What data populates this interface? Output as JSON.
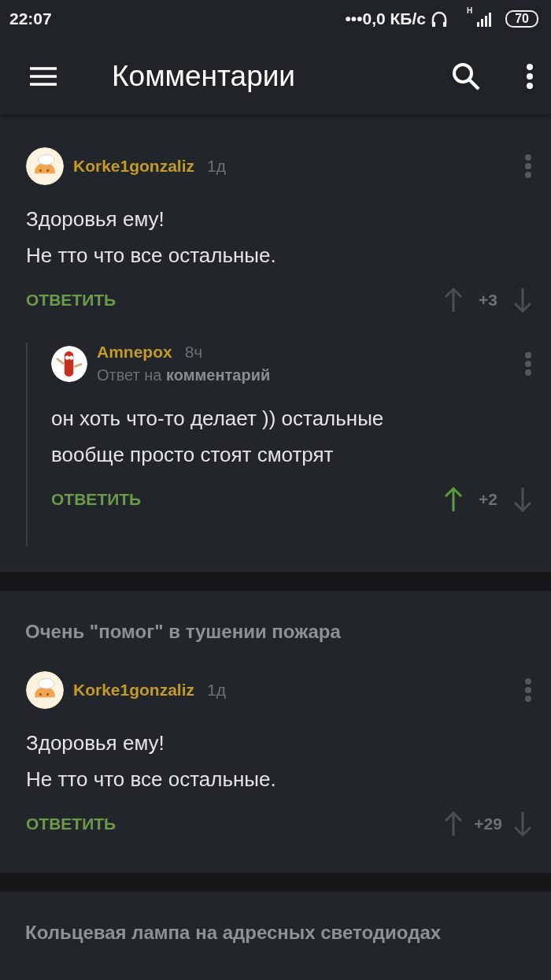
{
  "status_bar": {
    "time": "22:07",
    "speed": "•••0,0 КБ/с",
    "network": "H",
    "battery": "70"
  },
  "app_bar": {
    "title": "Комментарии"
  },
  "sections": [
    {
      "comments": [
        {
          "author": "Korke1gonzaliz",
          "avatar": {
            "kind": "chef"
          },
          "age": "1д",
          "lines": [
            "Здоровья ему!",
            "Не тто что все остальные."
          ],
          "reply_label": "ОТВЕТИТЬ",
          "score": "+3",
          "upvoted": false,
          "replies": [
            {
              "author": "Amnepox",
              "avatar": {
                "kind": "sausage"
              },
              "age": "8ч",
              "reply_to": "Ответ на **комментарий**",
              "lines": [
                "он хоть что-то делает )) остальные",
                "вообще просто стоят смотрят"
              ],
              "reply_label": "ОТВЕТИТЬ",
              "score": "+2",
              "upvoted": true
            }
          ]
        }
      ]
    },
    {
      "title": "Очень \"помог\" в тушении пожара",
      "comments": [
        {
          "author": "Korke1gonzaliz",
          "avatar": {
            "kind": "chef"
          },
          "age": "1д",
          "lines": [
            "Здоровья ему!",
            "Не тто что все остальные."
          ],
          "reply_label": "ОТВЕТИТЬ",
          "score": "+29",
          "upvoted": false
        }
      ]
    },
    {
      "title": "Кольцевая лампа на адресных светодиодах"
    }
  ]
}
